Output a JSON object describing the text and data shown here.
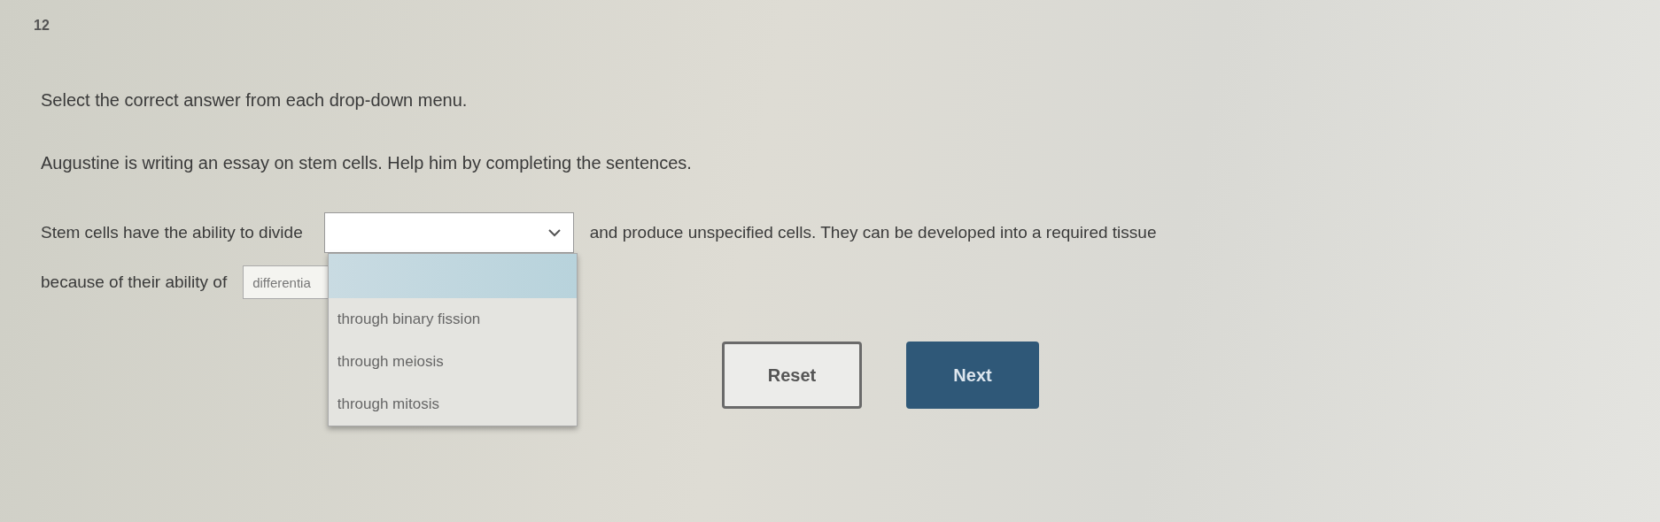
{
  "question_number": "12",
  "instruction": "Select the correct answer from each drop-down menu.",
  "prompt": "Augustine is writing an essay on stem cells. Help him by completing the sentences.",
  "sentence_1": {
    "before": "Stem cells have the ability to divide",
    "dropdown": {
      "expanded": true,
      "options": [
        {
          "highlighted": true
        },
        {
          "label": "through binary fission",
          "highlighted": false
        },
        {
          "label": "through meiosis",
          "highlighted": false
        },
        {
          "label": "through mitosis",
          "highlighted": false
        }
      ]
    },
    "after": "and produce unspecified cells. They can be developed into a required tissue"
  },
  "sentence_2": {
    "before": "because of their ability of",
    "dropdown": {
      "value": "differentia"
    }
  },
  "buttons": [
    {
      "label": "Reset",
      "kind": "secondary"
    },
    {
      "label": "Next",
      "kind": "primary"
    }
  ]
}
